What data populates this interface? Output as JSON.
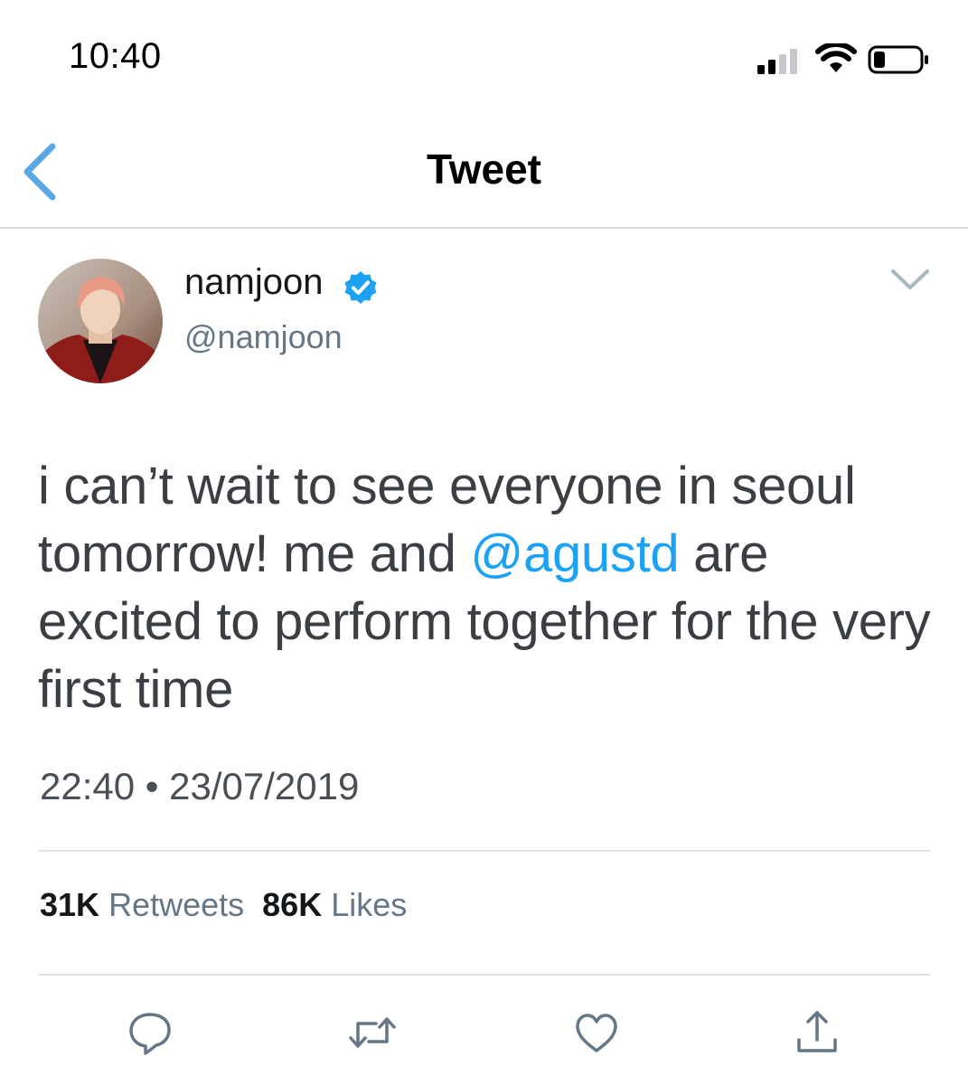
{
  "status_bar": {
    "time": "10:40"
  },
  "header": {
    "title": "Tweet",
    "back_icon": "chevron-left-icon"
  },
  "tweet": {
    "author": {
      "display_name": "namjoon",
      "handle": "@namjoon",
      "verified": true
    },
    "text_parts": {
      "before": "i can’t wait to see everyone in seoul tomorrow! me and ",
      "mention": "@agustd",
      "after": " are excited to perform together for the very first time"
    },
    "timestamp": "22:40 • 23/07/2019",
    "stats": {
      "retweets_count": "31K",
      "retweets_label": "Retweets",
      "likes_count": "86K",
      "likes_label": "Likes"
    },
    "actions": [
      "reply-icon",
      "retweet-icon",
      "like-icon",
      "share-icon"
    ]
  },
  "colors": {
    "accent": "#1da1f2",
    "back_chevron": "#5aa7e6",
    "verified": "#1da1f2",
    "text": "#3b3f44",
    "secondary": "#657786",
    "divider": "#dfe2e5"
  }
}
